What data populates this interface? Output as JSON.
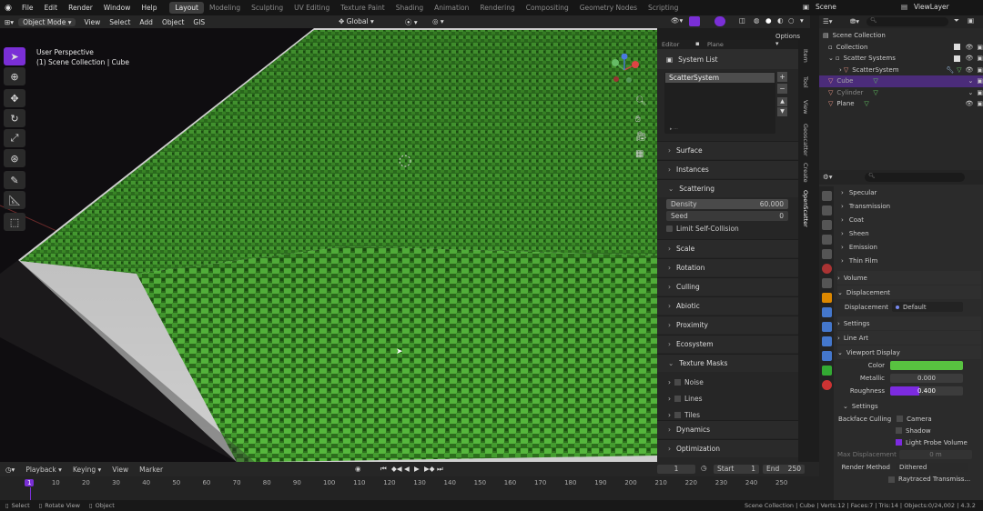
{
  "app": {
    "scene": "Scene",
    "view_layer": "ViewLayer"
  },
  "top_menu": [
    "File",
    "Edit",
    "Render",
    "Window",
    "Help"
  ],
  "workspaces": [
    "Layout",
    "Modeling",
    "Sculpting",
    "UV Editing",
    "Texture Paint",
    "Shading",
    "Animation",
    "Rendering",
    "Compositing",
    "Geometry Nodes",
    "Scripting"
  ],
  "header": {
    "mode": "Object Mode",
    "menus": [
      "View",
      "Select",
      "Add",
      "Object",
      "GIS"
    ],
    "orientation": "Global",
    "options": "Options"
  },
  "viewport": {
    "line1": "User Perspective",
    "line2": "(1) Scene Collection | Cube"
  },
  "npanel": {
    "editor": "Editor",
    "editor_target": "Plane",
    "system_list_title": "System List",
    "system_item": "ScatterSystem",
    "sections_top": [
      "Surface",
      "Instances"
    ],
    "scattering": {
      "title": "Scattering",
      "density_label": "Density",
      "density_value": "60.000",
      "seed_label": "Seed",
      "seed_value": "0",
      "limit": "Limit Self-Collision"
    },
    "sections_mid": [
      "Scale",
      "Rotation",
      "Culling",
      "Abiotic",
      "Proximity",
      "Ecosystem"
    ],
    "texture_masks": {
      "title": "Texture Masks",
      "items": [
        "Noise",
        "Lines",
        "Tiles"
      ]
    },
    "sections_bottom": [
      "Dynamics",
      "Optimization"
    ],
    "tabs": [
      "Item",
      "Tool",
      "View",
      "Geoscatter",
      "Create",
      "OpenScatter"
    ]
  },
  "outliner": {
    "search": "",
    "rows": [
      "Scene Collection",
      "Collection",
      "Scatter Systems",
      "ScatterSystem",
      "Cube",
      "Cylinder",
      "Plane"
    ]
  },
  "properties": {
    "search": "",
    "subpanels": [
      "Specular",
      "Transmission",
      "Coat",
      "Sheen",
      "Emission",
      "Thin Film"
    ],
    "volume": "Volume",
    "displacement_title": "Displacement",
    "displacement_label": "Displacement",
    "displacement_value": "Default",
    "settings": "Settings",
    "line_art": "Line Art",
    "viewport_display": "Viewport Display",
    "color_label": "Color",
    "metallic_label": "Metallic",
    "metallic_value": "0.000",
    "roughness_label": "Roughness",
    "roughness_value": "0.400",
    "settings2": "Settings",
    "backface": "Backface Culling",
    "camera": "Camera",
    "shadow": "Shadow",
    "light_probe": "Light Probe Volume",
    "max_disp_label": "Max Displacement",
    "max_disp_value": "0 m",
    "render_method_label": "Render Method",
    "render_method_value": "Dithered",
    "raytraced": "Raytraced Transmiss..."
  },
  "timeline": {
    "menus": [
      "Playback",
      "Keying",
      "View",
      "Marker"
    ],
    "current_frame": "1",
    "start_label": "Start",
    "start": "1",
    "end_label": "End",
    "end": "250",
    "ticks": [
      "1",
      "10",
      "20",
      "30",
      "40",
      "50",
      "60",
      "70",
      "80",
      "90",
      "100",
      "110",
      "120",
      "130",
      "140",
      "150",
      "160",
      "170",
      "180",
      "190",
      "200",
      "210",
      "220",
      "230",
      "240",
      "250"
    ]
  },
  "status": {
    "select": "Select",
    "rotate": "Rotate View",
    "object": "Object",
    "info": "Scene Collection | Cube | Verts:12 | Faces:7 | Tris:14 | Objects:0/24,002 | 4.3.2"
  },
  "colors": {
    "accent": "#7a2fd6",
    "grass": "#3d8a2a",
    "color_swatch": "#58c240",
    "roughness": "#7c2be0"
  }
}
